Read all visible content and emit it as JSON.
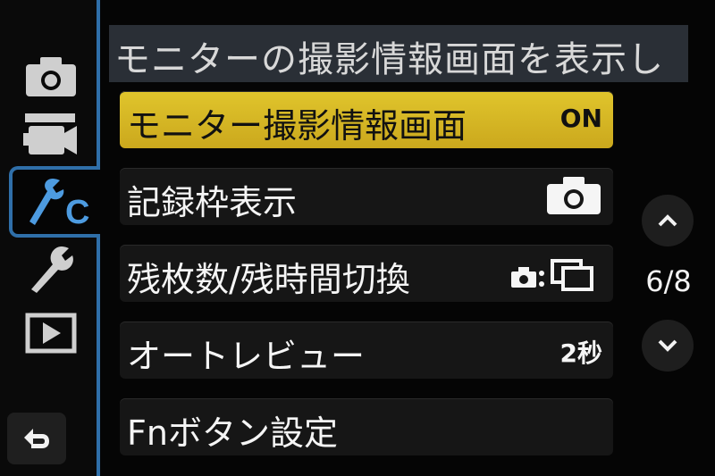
{
  "header": {
    "title": "モニターの撮影情報画面を表示し"
  },
  "tabs": [
    {
      "name": "photo",
      "icon": "camera-icon"
    },
    {
      "name": "movie",
      "icon": "movie-camera-icon"
    },
    {
      "name": "custom",
      "icon": "custom-wrench-c-icon"
    },
    {
      "name": "setup",
      "icon": "wrench-icon"
    },
    {
      "name": "playback",
      "icon": "play-icon"
    }
  ],
  "menu": [
    {
      "label": "モニター撮影情報画面",
      "value": "ON",
      "selected": true
    },
    {
      "label": "記録枠表示",
      "value_icon": "camera-icon"
    },
    {
      "label": "残枚数/残時間切換",
      "value_icon": "camera-frames-icon"
    },
    {
      "label": "オートレビュー",
      "value": "2秒"
    },
    {
      "label": "Fnボタン設定"
    }
  ],
  "scroll": {
    "page": "6/8",
    "up_icon": "chevron-up-icon",
    "down_icon": "chevron-down-icon"
  },
  "back": {
    "icon": "return-arrow-icon"
  },
  "colors": {
    "accent": "#2f6fa9",
    "selected": "#d9bb26"
  }
}
